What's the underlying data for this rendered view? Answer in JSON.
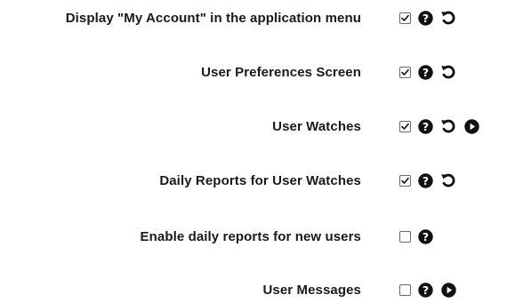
{
  "settings": {
    "rows": [
      {
        "label": "Display \"My Account\" in the application menu",
        "checked": true,
        "reset": true,
        "play": false
      },
      {
        "label": "User Preferences Screen",
        "checked": true,
        "reset": true,
        "play": false
      },
      {
        "label": "User Watches",
        "checked": true,
        "reset": true,
        "play": true
      },
      {
        "label": "Daily Reports for User Watches",
        "checked": true,
        "reset": true,
        "play": false
      },
      {
        "label": "Enable daily reports for new users",
        "checked": false,
        "reset": false,
        "play": false
      },
      {
        "label": "User Messages",
        "checked": false,
        "reset": false,
        "play": true
      }
    ]
  },
  "icons": {
    "checkbox": "checkbox-icon",
    "help": "help-icon",
    "reset": "reset-icon",
    "play": "play-icon"
  },
  "colors": {
    "text": "#1a1a1a",
    "icon": "#111111",
    "checkbox_border": "#6b6b6b"
  }
}
